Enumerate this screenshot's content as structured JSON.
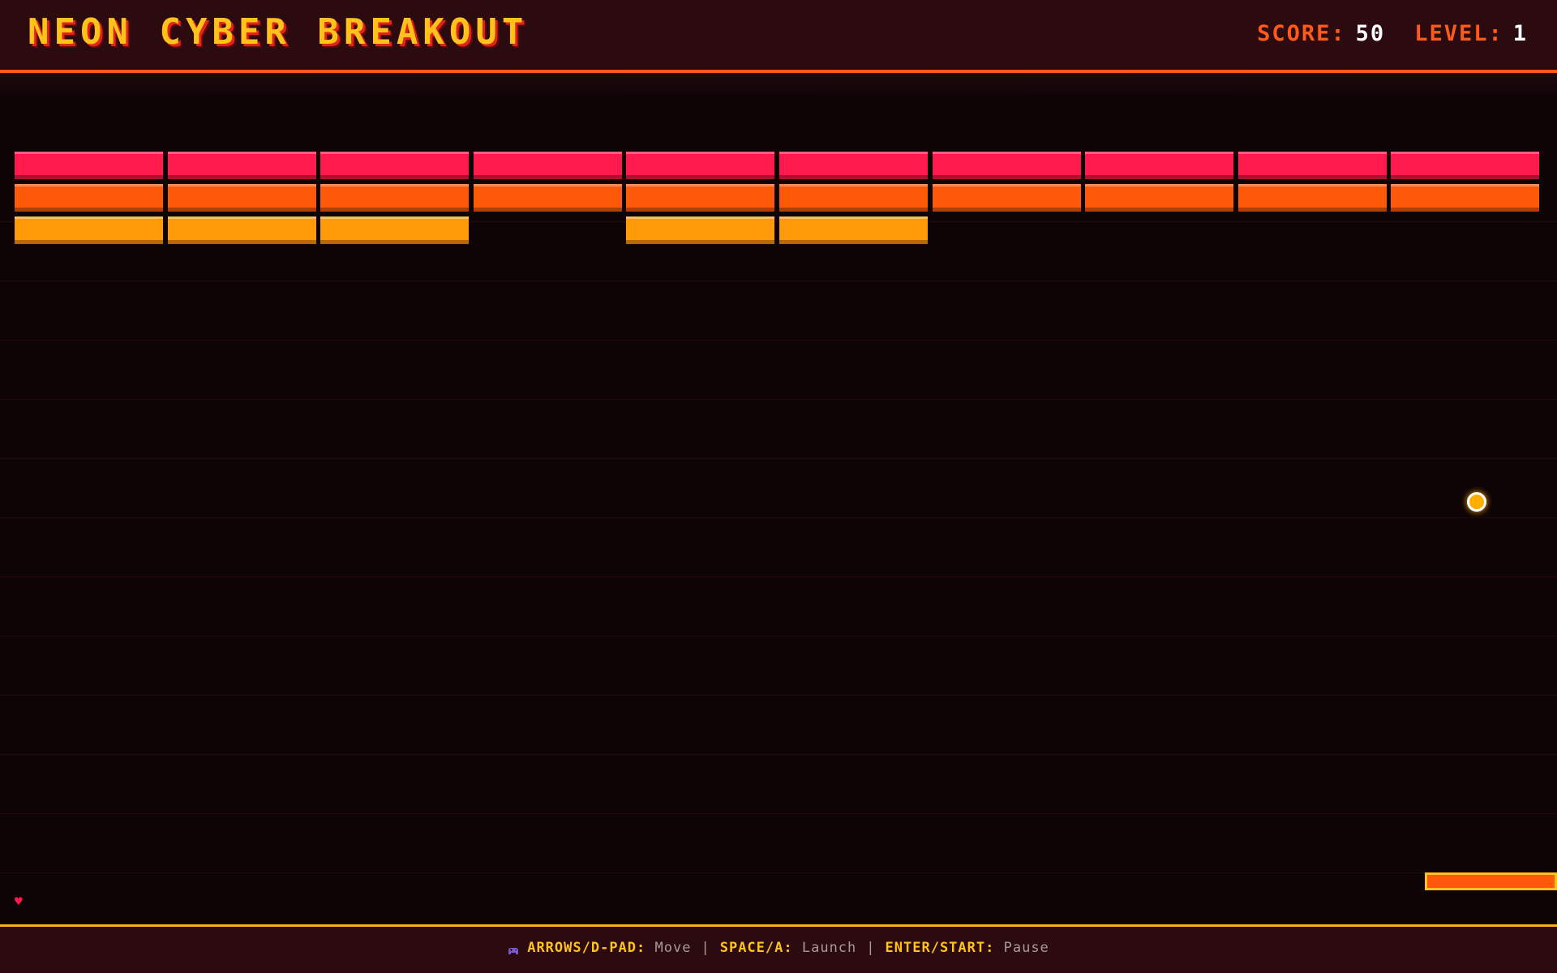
{
  "header": {
    "title": "NEON CYBER BREAKOUT",
    "score_label": "SCORE:",
    "score_value": "50",
    "level_label": "LEVEL:",
    "level_value": "1"
  },
  "game": {
    "lives": 1,
    "bricks": [
      {
        "row": 0,
        "col": 0,
        "color": "red"
      },
      {
        "row": 0,
        "col": 1,
        "color": "red"
      },
      {
        "row": 0,
        "col": 2,
        "color": "red"
      },
      {
        "row": 0,
        "col": 3,
        "color": "red"
      },
      {
        "row": 0,
        "col": 4,
        "color": "red"
      },
      {
        "row": 0,
        "col": 5,
        "color": "red"
      },
      {
        "row": 0,
        "col": 6,
        "color": "red"
      },
      {
        "row": 0,
        "col": 7,
        "color": "red"
      },
      {
        "row": 0,
        "col": 8,
        "color": "red"
      },
      {
        "row": 0,
        "col": 9,
        "color": "red"
      },
      {
        "row": 1,
        "col": 0,
        "color": "orange"
      },
      {
        "row": 1,
        "col": 1,
        "color": "orange"
      },
      {
        "row": 1,
        "col": 2,
        "color": "orange"
      },
      {
        "row": 1,
        "col": 3,
        "color": "orange"
      },
      {
        "row": 1,
        "col": 4,
        "color": "orange"
      },
      {
        "row": 1,
        "col": 5,
        "color": "orange"
      },
      {
        "row": 1,
        "col": 6,
        "color": "orange"
      },
      {
        "row": 1,
        "col": 7,
        "color": "orange"
      },
      {
        "row": 1,
        "col": 8,
        "color": "orange"
      },
      {
        "row": 1,
        "col": 9,
        "color": "orange"
      },
      {
        "row": 2,
        "col": 0,
        "color": "amber"
      },
      {
        "row": 2,
        "col": 1,
        "color": "amber"
      },
      {
        "row": 2,
        "col": 2,
        "color": "amber"
      },
      {
        "row": 2,
        "col": 4,
        "color": "amber"
      },
      {
        "row": 2,
        "col": 5,
        "color": "amber"
      }
    ],
    "colors": {
      "red": "#ff1a4e",
      "orange": "#ff5a0a",
      "amber": "#ff9a08",
      "ball": "#ffae00",
      "accent": "#ffc21a"
    }
  },
  "controls": {
    "icon": "gamepad-icon",
    "move_key": "ARROWS/D-PAD:",
    "move_action": "Move",
    "launch_key": "SPACE/A:",
    "launch_action": "Launch",
    "pause_key": "ENTER/START:",
    "pause_action": "Pause",
    "separator": "|"
  }
}
